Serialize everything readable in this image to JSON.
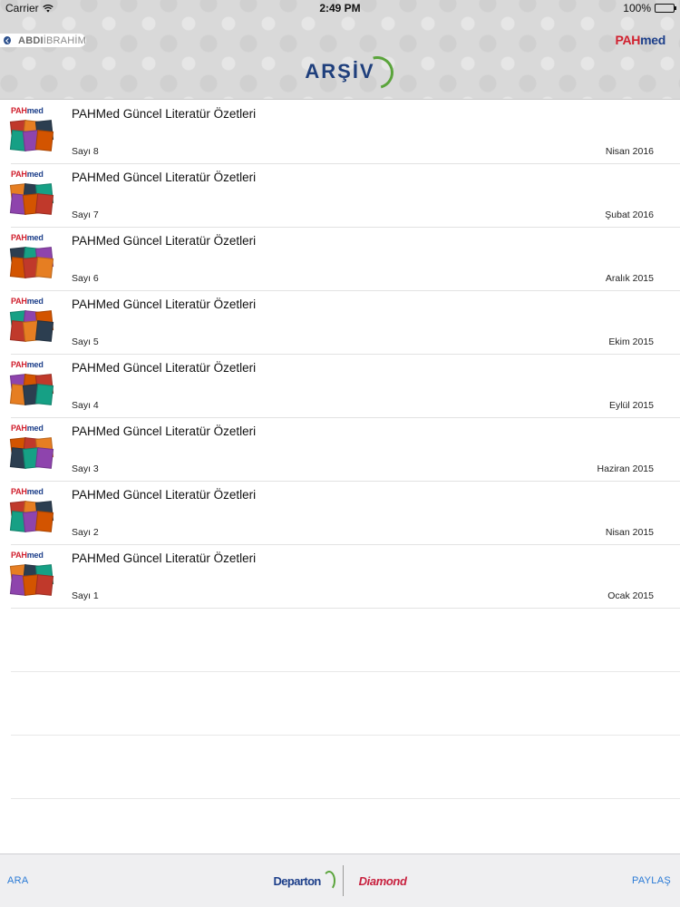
{
  "status": {
    "carrier": "Carrier",
    "wifi_icon": "wifi-icon",
    "time": "2:49 PM",
    "battery": "100%",
    "battery_level": 1.0
  },
  "header": {
    "brand_left_bold": "ABDI",
    "brand_left_light": "İBRAHİM",
    "logo_right_a": "PAH",
    "logo_right_b": "med",
    "title": "ARŞİV"
  },
  "items": [
    {
      "title": "PAHMed Güncel Literatür Özetleri",
      "issue": "Sayı 8",
      "date": "Nisan 2016"
    },
    {
      "title": "PAHMed Güncel Literatür Özetleri",
      "issue": "Sayı 7",
      "date": "Şubat 2016"
    },
    {
      "title": "PAHMed Güncel Literatür Özetleri",
      "issue": "Sayı 6",
      "date": "Aralık 2015"
    },
    {
      "title": "PAHMed Güncel Literatür Özetleri",
      "issue": "Sayı 5",
      "date": "Ekim 2015"
    },
    {
      "title": "PAHMed Güncel Literatür Özetleri",
      "issue": "Sayı 4",
      "date": "Eylül 2015"
    },
    {
      "title": "PAHMed Güncel Literatür Özetleri",
      "issue": "Sayı 3",
      "date": "Haziran 2015"
    },
    {
      "title": "PAHMed Güncel Literatür Özetleri",
      "issue": "Sayı 2",
      "date": "Nisan 2015"
    },
    {
      "title": "PAHMed Güncel Literatür Özetleri",
      "issue": "Sayı 1",
      "date": "Ocak 2015"
    }
  ],
  "thumb": {
    "logo_a": "PAH",
    "logo_b": "med"
  },
  "toolbar": {
    "left_label": "ARA",
    "right_label": "PAYLAŞ",
    "sponsor_a": "Departon",
    "sponsor_b": "Diamond"
  },
  "colors": {
    "accent_blue": "#2a7ad6",
    "brand_navy": "#1f3f7c",
    "brand_red": "#d0202e",
    "brand_green": "#5aa43b"
  }
}
